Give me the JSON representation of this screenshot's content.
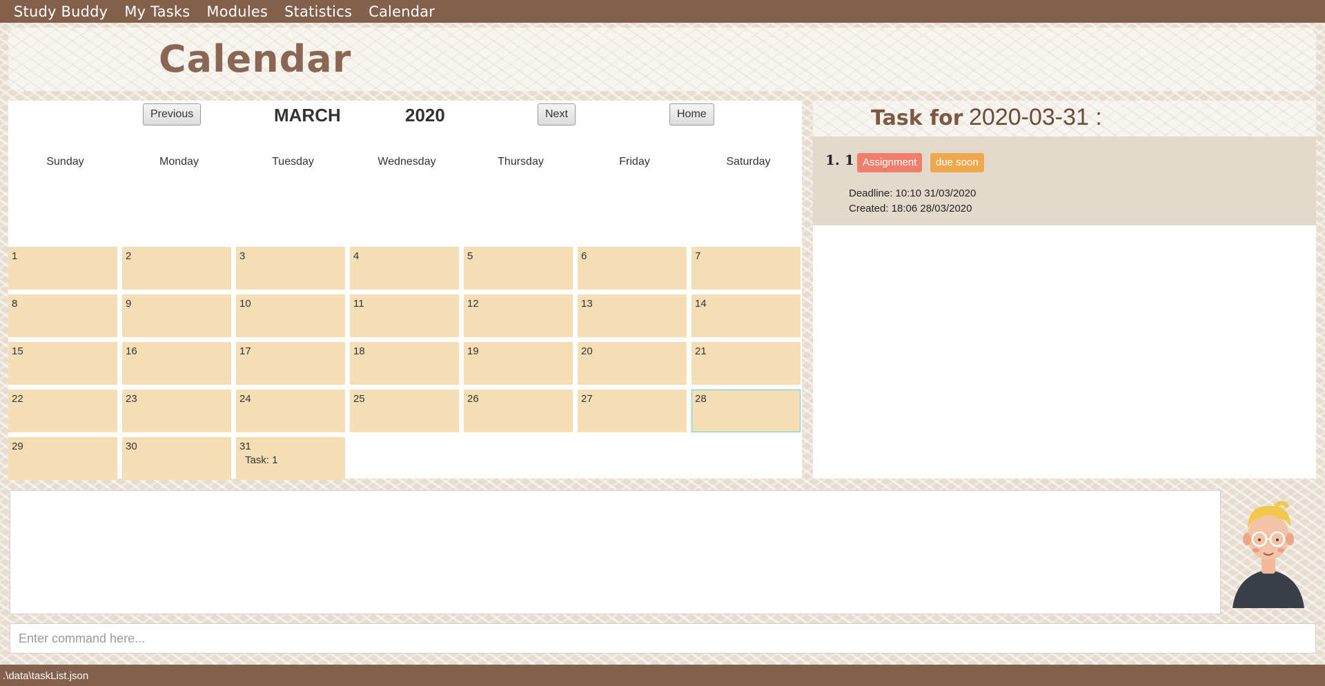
{
  "menu": {
    "items": [
      "Study Buddy",
      "My Tasks",
      "Modules",
      "Statistics",
      "Calendar"
    ]
  },
  "banner": {
    "title": "Calendar"
  },
  "calendar": {
    "month": "MARCH",
    "year": "2020",
    "buttons": {
      "previous": "Previous",
      "next": "Next",
      "home": "Home"
    },
    "weekdays": [
      "Sunday",
      "Monday",
      "Tuesday",
      "Wednesday",
      "Thursday",
      "Friday",
      "Saturday"
    ],
    "days": [
      {
        "num": "1"
      },
      {
        "num": "2"
      },
      {
        "num": "3"
      },
      {
        "num": "4"
      },
      {
        "num": "5"
      },
      {
        "num": "6"
      },
      {
        "num": "7"
      },
      {
        "num": "8"
      },
      {
        "num": "9"
      },
      {
        "num": "10"
      },
      {
        "num": "11"
      },
      {
        "num": "12"
      },
      {
        "num": "13"
      },
      {
        "num": "14"
      },
      {
        "num": "15"
      },
      {
        "num": "16"
      },
      {
        "num": "17"
      },
      {
        "num": "18"
      },
      {
        "num": "19"
      },
      {
        "num": "20"
      },
      {
        "num": "21"
      },
      {
        "num": "22"
      },
      {
        "num": "23"
      },
      {
        "num": "24"
      },
      {
        "num": "25"
      },
      {
        "num": "26"
      },
      {
        "num": "27"
      },
      {
        "num": "28",
        "selected": true
      },
      {
        "num": "29"
      },
      {
        "num": "30"
      },
      {
        "num": "31",
        "task": "Task: 1"
      }
    ]
  },
  "task_panel": {
    "label": "Task for",
    "date": "2020-03-31 :",
    "tasks": [
      {
        "index": "1.",
        "name": "1",
        "type": "Assignment",
        "status": "due soon",
        "deadline": "Deadline: 10:10 31/03/2020",
        "created": "Created: 18:06 28/03/2020"
      }
    ]
  },
  "command": {
    "placeholder": "Enter command here..."
  },
  "status_bar": {
    "path": ".\\data\\taskList.json"
  },
  "colors": {
    "menubar": "#82604c",
    "day_cell": "#f5deb5",
    "selected_border": "#5ad8d3",
    "badge_assignment": "#ef7e6c",
    "badge_due_soon": "#f0a94a",
    "task_card": "#e3dacb"
  },
  "icons": {
    "avatar": "avatar-illustration"
  }
}
